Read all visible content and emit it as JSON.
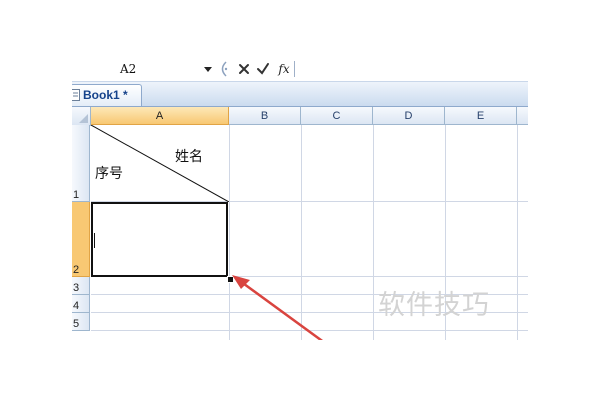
{
  "formula_bar": {
    "name_box": "A2",
    "fx_label": "fx",
    "formula": ""
  },
  "workbook_tab": {
    "label": "Book1 *"
  },
  "columns": [
    "A",
    "B",
    "C",
    "D",
    "E"
  ],
  "rows": [
    "1",
    "2",
    "3",
    "4",
    "5"
  ],
  "cells": {
    "a1_top_right": "姓名",
    "a1_bottom_left": "序号"
  },
  "watermark": "软件技巧",
  "colors": {
    "selection_accent": "#f8c873",
    "arrow": "#d9443f",
    "gridline": "#d0d7e5"
  }
}
